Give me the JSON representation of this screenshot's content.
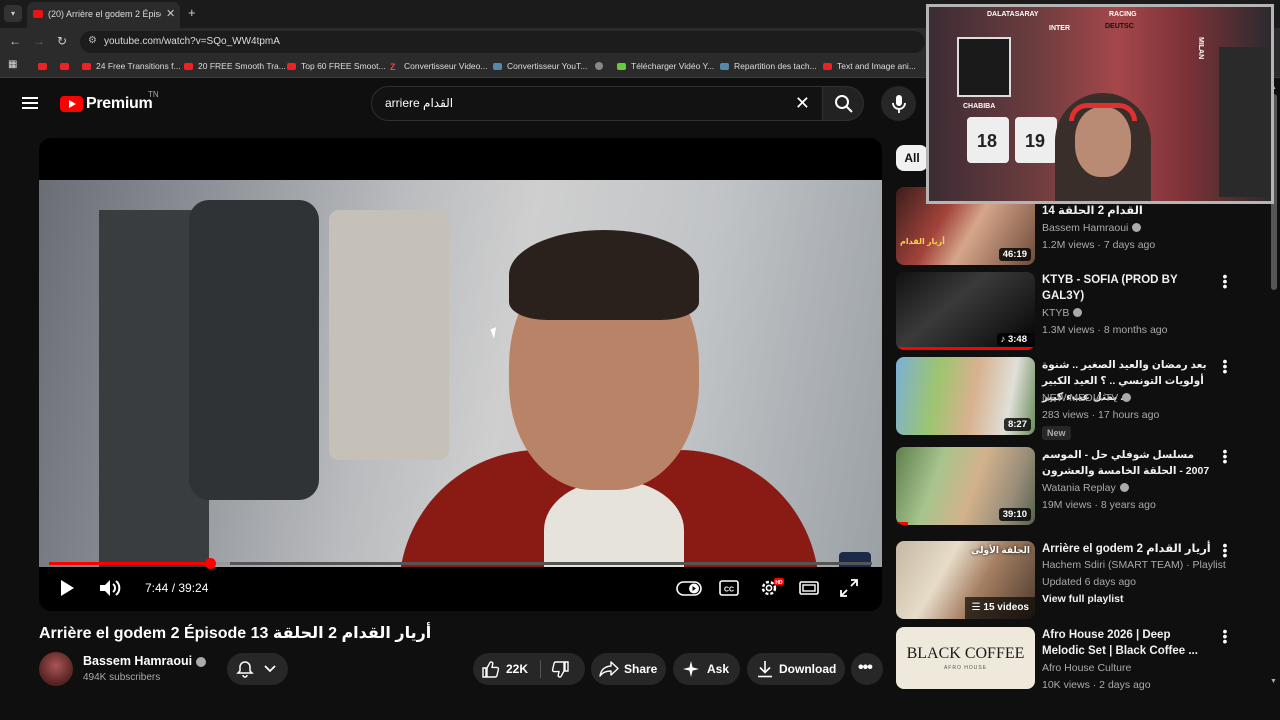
{
  "browser": {
    "tab_title": "(20) Arrière el godem 2 Épisode",
    "url": "youtube.com/watch?v=SQo_WW4tpmA",
    "bookmarks": [
      {
        "label": "",
        "icon": "youtube-icon"
      },
      {
        "label": "",
        "icon": "youtube-icon"
      },
      {
        "label": "24 Free Transitions f...",
        "icon": "youtube-icon"
      },
      {
        "label": "20 FREE Smooth Tra...",
        "icon": "youtube-icon"
      },
      {
        "label": "Top 60 FREE Smoot...",
        "icon": "youtube-icon"
      },
      {
        "label": "Convertisseur Video...",
        "icon": "z-icon"
      },
      {
        "label": "Convertisseur YouT...",
        "icon": "converter-icon"
      },
      {
        "label": "",
        "icon": "globe-icon"
      },
      {
        "label": "Télécharger Vidéo Y...",
        "icon": "download-icon"
      },
      {
        "label": "Repartition des tach...",
        "icon": "doc-icon"
      },
      {
        "label": "Text and Image ani...",
        "icon": "youtube-icon"
      }
    ]
  },
  "header": {
    "logo_text": "Premium",
    "country_code": "TN",
    "search_query": "arriere القدام"
  },
  "player": {
    "time": "7:44 / 39:24",
    "progress": 0.196,
    "buffered": 0.22
  },
  "video": {
    "title": "Arrière el godem 2 Épisode 13 أريار القدام 2 الحلقة",
    "channel": "Bassem Hamraoui",
    "subscribers": "494K subscribers",
    "likes": "22K",
    "share_label": "Share",
    "ask_label": "Ask",
    "download_label": "Download"
  },
  "sidebar": {
    "chip": "All",
    "items": [
      {
        "title": "القدام 2 الحلقة 14",
        "channel": "Bassem Hamraoui",
        "meta": "1.2M views · 7 days ago",
        "duration": "46:19",
        "verified": true
      },
      {
        "title": "KTYB - SOFIA (PROD BY GAL3Y)",
        "channel": "KTYB",
        "meta": "1.3M views · 8 months ago",
        "duration": "3:48",
        "verified": true
      },
      {
        "title": "بعد رمضان والعيد الصغير .. شنوة أولويات التونسي .. ؟ العيد الكبير يمثل عبء كبير ...",
        "channel": "NEW MEDIA TV",
        "meta": "283 views · 17 hours ago",
        "duration": "8:27",
        "verified": true,
        "badge": "New"
      },
      {
        "title": "مسلسل شوفلي حل - الموسم 2007 - الحلقة الخامسة والعشرون",
        "channel": "Watania Replay",
        "meta": "19M views · 8 years ago",
        "duration": "39:10",
        "verified": true
      },
      {
        "title": "Arrière el godem 2 أريار القدام",
        "channel": "Hachem Sdiri (SMART TEAM) · Playlist",
        "meta": "Updated 6 days ago",
        "playlist_count": "15 videos",
        "view_full": "View full playlist"
      },
      {
        "title": "Afro House 2026 | Deep Melodic Set | Black Coffee ...",
        "channel": "Afro House Culture",
        "meta": "10K views · 2 days ago",
        "thumb_text": "BLACK COFFEE",
        "thumb_sub": "AFRO HOUSE"
      }
    ]
  },
  "webcam": {
    "labels": [
      "DALATASARAY",
      "DEUTSC",
      "INTER",
      "CHABIBA",
      "RACING",
      "MILAN"
    ]
  }
}
